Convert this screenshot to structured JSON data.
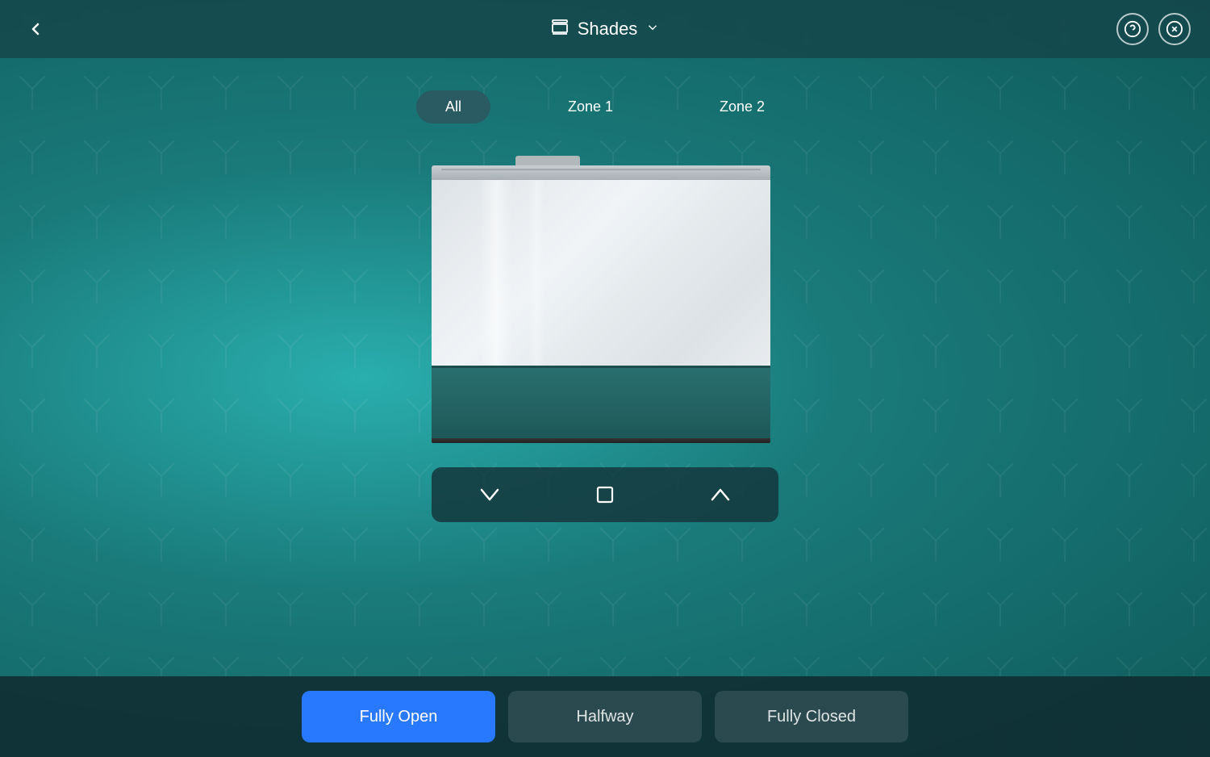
{
  "header": {
    "back_label": "Back",
    "title": "Shades",
    "help_label": "Help",
    "close_label": "Close"
  },
  "tabs": [
    {
      "id": "all",
      "label": "All",
      "active": true
    },
    {
      "id": "zone1",
      "label": "Zone 1",
      "active": false
    },
    {
      "id": "zone2",
      "label": "Zone 2",
      "active": false
    }
  ],
  "controls": {
    "down_label": "Down",
    "stop_label": "Stop",
    "up_label": "Up"
  },
  "presets": [
    {
      "id": "fully-open",
      "label": "Fully Open",
      "active": true
    },
    {
      "id": "halfway",
      "label": "Halfway",
      "active": false
    },
    {
      "id": "fully-closed",
      "label": "Fully Closed",
      "active": false
    }
  ],
  "colors": {
    "active_tab_bg": "#2a5a62",
    "active_preset_bg": "#2979ff",
    "inactive_preset_bg": "#2a4a50",
    "header_bg": "rgba(20,70,75,0.85)",
    "bg_start": "#2aaeae",
    "bg_end": "#0f5a5a"
  }
}
